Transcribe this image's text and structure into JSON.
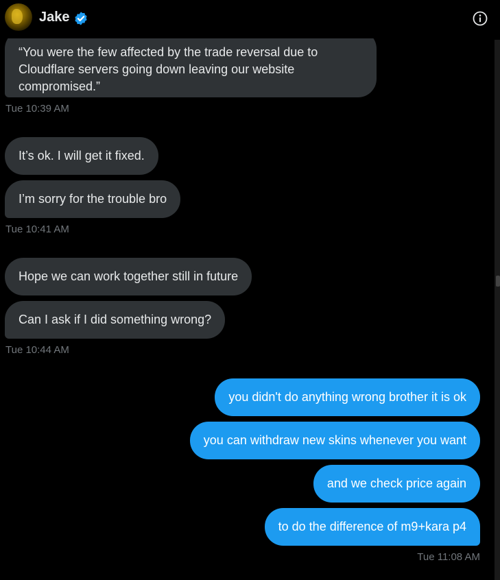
{
  "header": {
    "name": "Jake",
    "verified_icon": "verified-badge-icon",
    "info_icon": "info-icon",
    "colors": {
      "verified": "#1d9bf0"
    }
  },
  "messages": [
    {
      "direction": "in",
      "text": "“You were the few affected by the trade reversal due to Cloudflare servers going down leaving our website compromised.”"
    },
    {
      "direction": "in",
      "text": "It’s ok. I will get it fixed."
    },
    {
      "direction": "in",
      "text": "I’m sorry for the trouble bro"
    },
    {
      "direction": "in",
      "text": "Hope we can work together still in future"
    },
    {
      "direction": "in",
      "text": "Can I ask if I did something wrong?"
    },
    {
      "direction": "out",
      "text": "you didn't do anything wrong brother it is ok"
    },
    {
      "direction": "out",
      "text": "you can withdraw new skins whenever you want"
    },
    {
      "direction": "out",
      "text": "and we check price again"
    },
    {
      "direction": "out",
      "text": "to do the difference of m9+kara p4"
    }
  ],
  "timestamps": [
    "Tue 10:39 AM",
    "Tue 10:41 AM",
    "Tue 10:44 AM",
    "Tue 11:08 AM"
  ],
  "colors": {
    "incoming_bubble": "#2f3336",
    "outgoing_bubble": "#1d9bf0",
    "timestamp": "#71767b"
  }
}
